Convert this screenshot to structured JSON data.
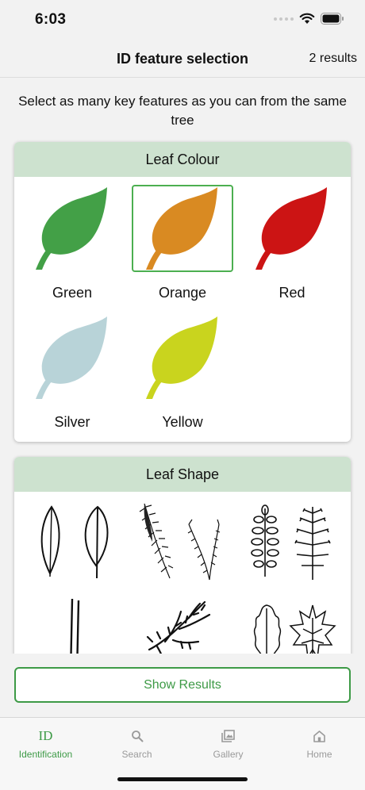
{
  "status_bar": {
    "time": "6:03"
  },
  "nav": {
    "title": "ID feature selection",
    "results": "2 results"
  },
  "instructions": "Select as many key features as you can from the same tree",
  "leaf_colour": {
    "heading": "Leaf Colour",
    "options": [
      {
        "label": "Green",
        "color": "#43a047",
        "selected": false
      },
      {
        "label": "Orange",
        "color": "#d98a22",
        "selected": true
      },
      {
        "label": "Red",
        "color": "#cc1414",
        "selected": false
      },
      {
        "label": "Silver",
        "color": "#b8d3d8",
        "selected": false
      },
      {
        "label": "Yellow",
        "color": "#c9d41e",
        "selected": false
      }
    ]
  },
  "leaf_shape": {
    "heading": "Leaf Shape",
    "options": [
      "simple-leaf-drawing-icon",
      "needle-cluster-drawing-icon",
      "pinnate-leaf-drawing-icon",
      "single-needle-drawing-icon",
      "scale-leaf-drawing-icon",
      "lobed-leaf-drawing-icon"
    ]
  },
  "actions": {
    "show_results": "Show Results"
  },
  "tabs": [
    {
      "label": "Identification",
      "icon_text": "ID",
      "active": true
    },
    {
      "label": "Search",
      "active": false
    },
    {
      "label": "Gallery",
      "active": false
    },
    {
      "label": "Home",
      "active": false
    }
  ],
  "colors": {
    "accent": "#3d9a46",
    "header_band": "#cde2cf"
  }
}
